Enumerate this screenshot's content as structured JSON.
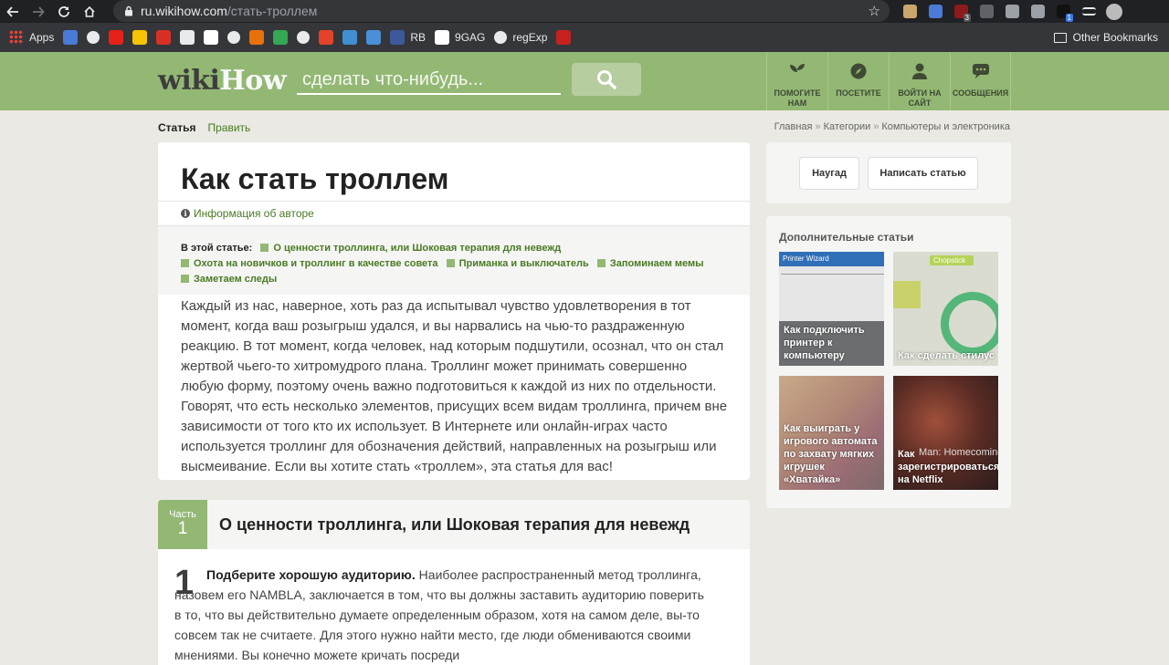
{
  "browser": {
    "url_host": "ru.wikihow.com",
    "url_path": "/стать-троллем",
    "extensions": [
      {
        "name": "folder-ext-icon",
        "color": "#c9a66b",
        "badge": ""
      },
      {
        "name": "translate-ext-icon",
        "color": "#4a7bd6",
        "badge": ""
      },
      {
        "name": "ublock-ext-icon",
        "color": "#8e1b1b",
        "badge": "3"
      },
      {
        "name": "crosshair-ext-icon",
        "color": "#5f6368",
        "badge": ""
      },
      {
        "name": "target-ext-icon",
        "color": "#9aa0a6",
        "badge": ""
      },
      {
        "name": "edit-ext-icon",
        "color": "#9aa0a6",
        "badge": ""
      },
      {
        "name": "cube-ext-icon",
        "color": "#111111",
        "badge": "1"
      },
      {
        "name": "playlist-icon",
        "color": "#e8eaed",
        "badge": ""
      },
      {
        "name": "profile-avatar",
        "color": "#bbbbbb",
        "badge": ""
      }
    ]
  },
  "bookmarks": {
    "items": [
      {
        "label": "Apps",
        "icon": "apps-grid-icon",
        "color": "#e8eaed"
      },
      {
        "label": "",
        "icon": "translate-icon",
        "color": "#4a7bd6"
      },
      {
        "label": "",
        "icon": "globe-icon",
        "color": "#e8eaed"
      },
      {
        "label": "",
        "icon": "youtube-icon",
        "color": "#e62117"
      },
      {
        "label": "",
        "icon": "ch-icon",
        "color": "#f5c300"
      },
      {
        "label": "",
        "icon": "figure-icon",
        "color": "#d93025"
      },
      {
        "label": "",
        "icon": "cube-icon",
        "color": "#e8eaed"
      },
      {
        "label": "",
        "icon": "medium-icon",
        "color": "#ffffff"
      },
      {
        "label": "",
        "icon": "globe2-icon",
        "color": "#e8eaed"
      },
      {
        "label": "",
        "icon": "grid-orange-icon",
        "color": "#e8710a"
      },
      {
        "label": "",
        "icon": "drive-icon",
        "color": "#34a853"
      },
      {
        "label": "",
        "icon": "github-icon",
        "color": "#e8eaed"
      },
      {
        "label": "",
        "icon": "gitlab-icon",
        "color": "#e24329"
      },
      {
        "label": "",
        "icon": "drop-icon",
        "color": "#3f8fd2"
      },
      {
        "label": "",
        "icon": "wave-icon",
        "color": "#4a90d9"
      },
      {
        "label": "RB",
        "icon": "flag-icon",
        "color": "#3c5a9a"
      },
      {
        "label": "9GAG",
        "icon": "9gag-icon",
        "color": "#ffffff"
      },
      {
        "label": "regExp",
        "icon": "github2-icon",
        "color": "#e8eaed"
      },
      {
        "label": "",
        "icon": "picture-icon",
        "color": "#c5221f"
      }
    ],
    "other": "Other Bookmarks"
  },
  "header": {
    "logo_wiki": "wiki",
    "logo_how": "How",
    "search_placeholder": "сделать что-нибудь...",
    "nav": [
      {
        "name": "nav-help-us",
        "icon": "sprout-icon",
        "label": "ПОМОГИТЕ НАМ"
      },
      {
        "name": "nav-explore",
        "icon": "compass-icon",
        "label": "ПОСЕТИТЕ"
      },
      {
        "name": "nav-login",
        "icon": "user-icon",
        "label": "ВОЙТИ НА САЙТ"
      },
      {
        "name": "nav-messages",
        "icon": "chat-icon",
        "label": "СООБЩЕНИЯ"
      }
    ]
  },
  "tabs": {
    "article": "Статья",
    "edit": "Править"
  },
  "breadcrumb": [
    "Главная",
    "Категории",
    "Компьютеры и электроника"
  ],
  "article": {
    "title": "Как стать троллем",
    "author_info": "Информация об авторе",
    "toc_label": "В этой статье:",
    "toc_items": [
      "О ценности троллинга, или Шоковая терапия для невежд",
      "Охота на новичков и троллинг в качестве совета",
      "Приманка и выключатель",
      "Запоминаем мемы",
      "Заметаем следы"
    ],
    "intro": "Каждый из нас, наверное, хоть раз да испытывал чувство удовлетворения в тот момент, когда ваш розыгрыш удался, и вы нарвались на чью-то раздраженную реакцию. В тот момент, когда человек, над которым подшутили, осознал, что он стал жертвой чьего-то хитромудрого плана. Троллинг может принимать совершенно любую форму, поэтому очень важно подготовиться к каждой из них по отдельности. Говорят, что есть несколько элементов, присущих всем видам троллинга, причем вне зависимости от того кто их использует. В Интернете или онлайн-играх часто используется троллинг для обозначения действий, направленных на розыгрыш или высмеивание. Если вы хотите стать «троллем», эта статья для вас!"
  },
  "part": {
    "label": "Часть",
    "number": "1",
    "title": "О ценности троллинга, или Шоковая терапия для невежд",
    "step_number": "1",
    "step_bold": "Подберите хорошую аудиторию.",
    "step_text": " Наиболее распространенный метод троллинга, назовем его NAMBLA, заключается в том, что вы должны заставить аудиторию поверить в то, что вы действительно думаете определенным образом, хотя на самом деле, вы-то совсем так не считаете. Для этого нужно найти место, где люди обмениваются своими мнениями. Вы конечно можете кричать посреди"
  },
  "sidebar": {
    "random_button": "Наугад",
    "write_button": "Написать статью",
    "related_title": "Дополнительные статьи",
    "related": [
      {
        "caption": "Как подключить принтер к компьютеру",
        "image_text": "Printer Wizard"
      },
      {
        "caption": "Как сделать стилус",
        "image_text": "Chopstick"
      },
      {
        "caption": "Как выиграть у игрового автомата по захвату мягких игрушек «Хватайка»",
        "image_text": ""
      },
      {
        "caption": "Как зарегистрироваться на Netflix",
        "image_text": "Man: Homecoming"
      }
    ]
  }
}
